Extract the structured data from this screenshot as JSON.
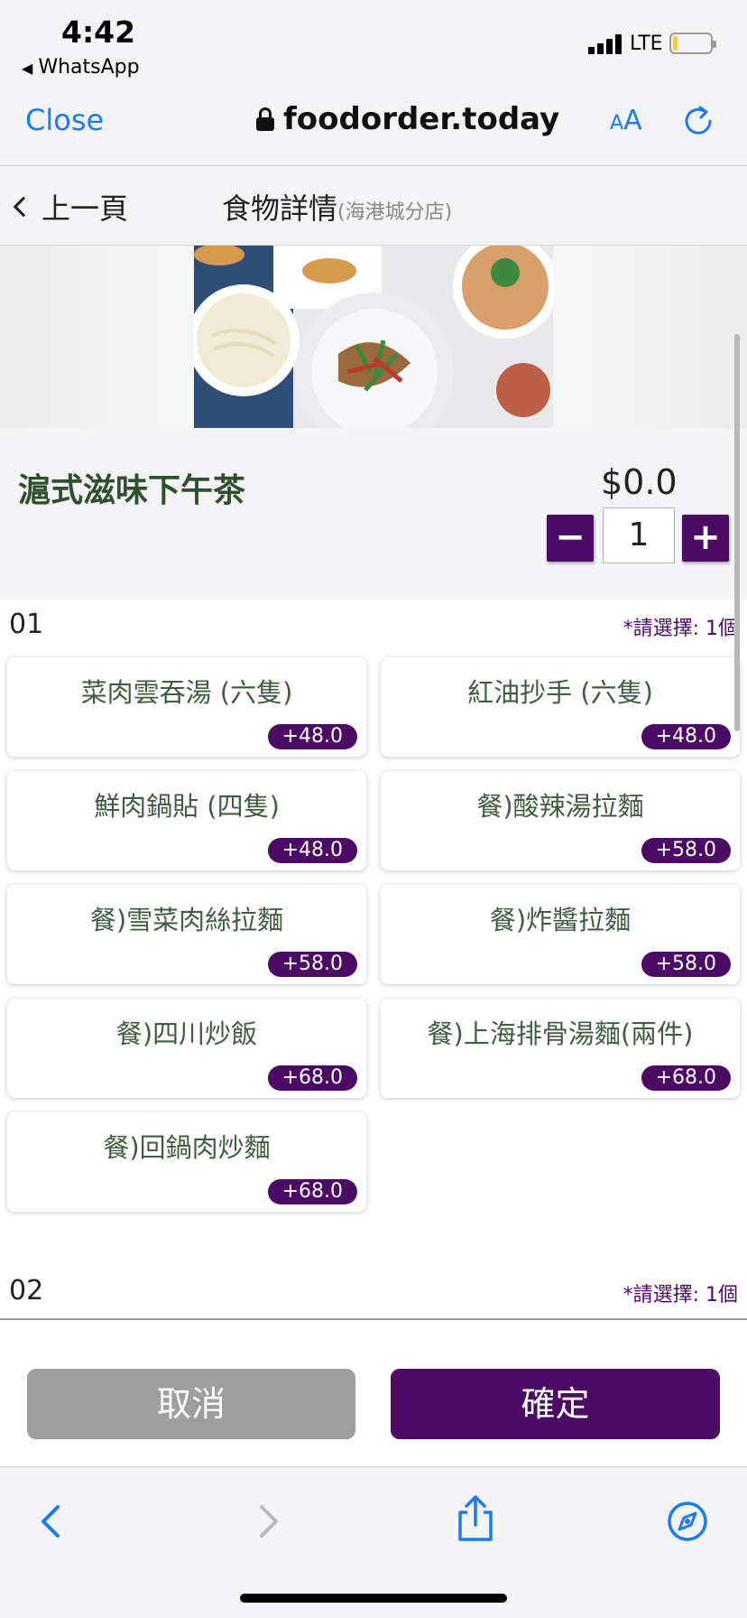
{
  "status": {
    "time": "4:42",
    "back_app": "WhatsApp",
    "network": "LTE"
  },
  "browser": {
    "close_label": "Close",
    "url": "foodorder.today",
    "text_size_label_small": "A",
    "text_size_label_large": "A"
  },
  "header": {
    "back_label": "上一頁",
    "title": "食物詳情",
    "subtitle": "(海港城分店)"
  },
  "item": {
    "name": "滬式滋味下午茶",
    "price": "$0.0",
    "quantity": "1",
    "minus_label": "−",
    "plus_label": "+"
  },
  "groups": [
    {
      "number": "01",
      "requirement": "*請選擇: 1個",
      "options": [
        {
          "label": "菜肉雲吞湯 (六隻)",
          "price": "+48.0"
        },
        {
          "label": "紅油抄手 (六隻)",
          "price": "+48.0"
        },
        {
          "label": "鮮肉鍋貼 (四隻)",
          "price": "+48.0"
        },
        {
          "label": "餐)酸辣湯拉麵",
          "price": "+58.0"
        },
        {
          "label": "餐)雪菜肉絲拉麵",
          "price": "+58.0"
        },
        {
          "label": "餐)炸醬拉麵",
          "price": "+58.0"
        },
        {
          "label": "餐)四川炒飯",
          "price": "+68.0"
        },
        {
          "label": "餐)上海排骨湯麵(兩件)",
          "price": "+68.0"
        },
        {
          "label": "餐)回鍋肉炒麵",
          "price": "+68.0"
        }
      ]
    },
    {
      "number": "02",
      "requirement": "*請選擇: 1個",
      "options": []
    }
  ],
  "footer": {
    "cancel_label": "取消",
    "confirm_label": "確定"
  },
  "colors": {
    "accent": "#4b0a64",
    "ios_blue": "#1a7bf2",
    "item_text": "#3f5d3f",
    "cancel_gray": "#9e9e9e"
  },
  "icons": {
    "toolbar": [
      "back-icon",
      "forward-icon",
      "share-icon",
      "compass-icon"
    ]
  }
}
